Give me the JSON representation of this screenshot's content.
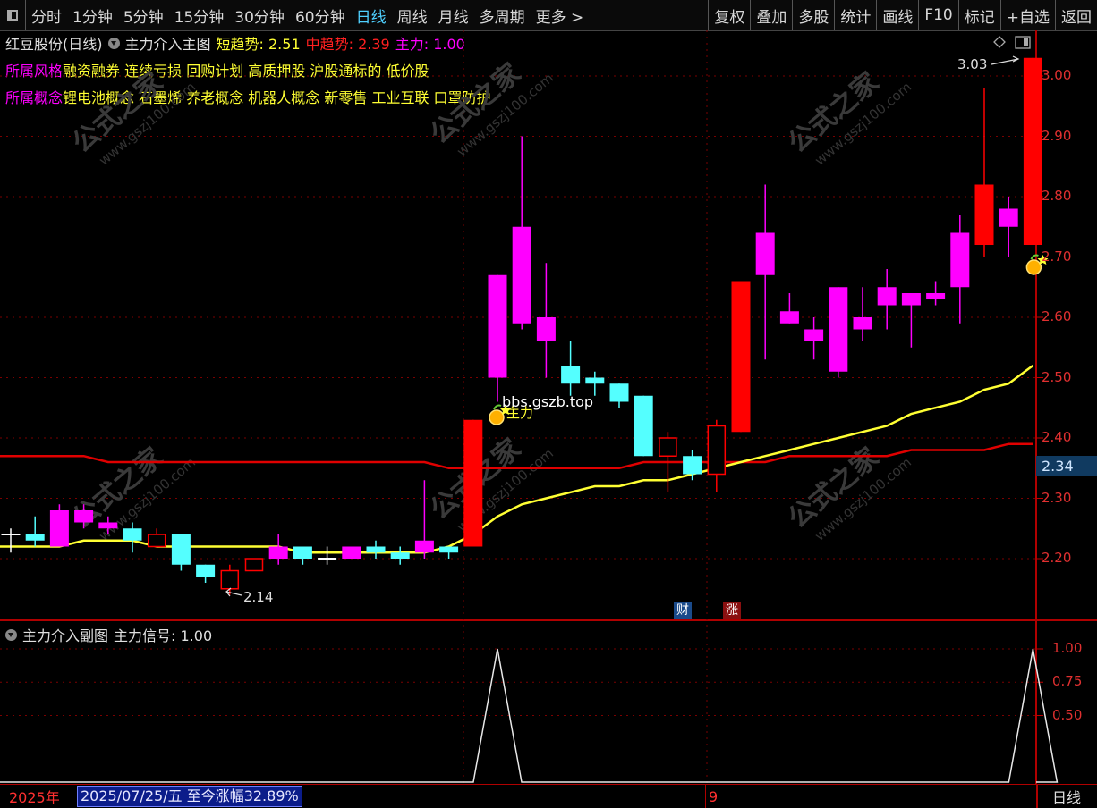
{
  "toolbar": {
    "periods": [
      {
        "label": "分时"
      },
      {
        "label": "1分钟"
      },
      {
        "label": "5分钟"
      },
      {
        "label": "15分钟"
      },
      {
        "label": "30分钟"
      },
      {
        "label": "60分钟"
      },
      {
        "label": "日线",
        "active": true
      },
      {
        "label": "周线"
      },
      {
        "label": "月线"
      },
      {
        "label": "多周期"
      },
      {
        "label": "更多 >"
      }
    ],
    "tools": [
      {
        "label": "复权"
      },
      {
        "label": "叠加"
      },
      {
        "label": "多股"
      },
      {
        "label": "统计"
      },
      {
        "label": "画线"
      },
      {
        "label": "F10"
      },
      {
        "label": "标记"
      },
      {
        "label": "+自选"
      },
      {
        "label": "返回"
      }
    ]
  },
  "main": {
    "stock_title": "红豆股份(日线)",
    "indicator_name": "主力介入主图",
    "short_trend": "短趋势: 2.51",
    "mid_trend": "中趋势: 2.39",
    "main_force": "主力: 1.00",
    "style_label": "所属风格",
    "style_value": "融资融券 连续亏损 回购计划 高质押股 沪股通标的 低价股",
    "concept_label": "所属概念",
    "concept_value": "锂电池概念 石墨烯 养老概念 机器人概念 新零售 工业互联 口罩防护",
    "watermark_text": "公式之家",
    "watermark_url": "www.gszj100.com",
    "overlay_url": "bbs.gszb.top",
    "signal_label": "主力",
    "high_label": "3.03",
    "low_label": "2.14",
    "current_price_label": "2.34",
    "marker_cai": "财",
    "marker_zhang": "涨",
    "price_axis": [
      "3.00",
      "2.90",
      "2.80",
      "2.70",
      "2.60",
      "2.50",
      "2.40",
      "2.30",
      "2.20"
    ]
  },
  "sub": {
    "indicator_name": "主力介入副图",
    "signal": "主力信号: 1.00",
    "axis": [
      "1.00",
      "0.75",
      "0.50"
    ]
  },
  "bottom": {
    "year": "2025年",
    "cursor_info": "2025/07/25/五  至今涨幅32.89%",
    "month_tick": "9",
    "period": "日线"
  },
  "colors": {
    "up": "#ff0000",
    "down": "#54ffff",
    "magenta": "#ff00ff",
    "ma_long": "#e00000",
    "ma_short": "#ffff33",
    "grid": "#7a0000"
  },
  "chart_data": {
    "type": "candlestick",
    "ylim": [
      2.15,
      3.05
    ],
    "candles": [
      {
        "o": 2.23,
        "c": 2.24,
        "h": 2.25,
        "l": 2.21,
        "color": "white"
      },
      {
        "o": 2.23,
        "c": 2.24,
        "h": 2.27,
        "l": 2.22,
        "color": "cyan"
      },
      {
        "o": 2.22,
        "c": 2.28,
        "h": 2.29,
        "l": 2.22,
        "color": "magenta"
      },
      {
        "o": 2.26,
        "c": 2.28,
        "h": 2.29,
        "l": 2.25,
        "color": "magenta"
      },
      {
        "o": 2.25,
        "c": 2.26,
        "h": 2.27,
        "l": 2.24,
        "color": "magenta"
      },
      {
        "o": 2.25,
        "c": 2.23,
        "h": 2.26,
        "l": 2.21,
        "color": "cyan"
      },
      {
        "o": 2.22,
        "c": 2.24,
        "h": 2.25,
        "l": 2.22,
        "color": "red-hollow"
      },
      {
        "o": 2.24,
        "c": 2.19,
        "h": 2.24,
        "l": 2.18,
        "color": "cyan"
      },
      {
        "o": 2.19,
        "c": 2.17,
        "h": 2.19,
        "l": 2.16,
        "color": "cyan"
      },
      {
        "o": 2.15,
        "c": 2.18,
        "h": 2.19,
        "l": 2.14,
        "color": "red-hollow"
      },
      {
        "o": 2.18,
        "c": 2.2,
        "h": 2.2,
        "l": 2.18,
        "color": "red-hollow"
      },
      {
        "o": 2.2,
        "c": 2.22,
        "h": 2.24,
        "l": 2.19,
        "color": "magenta"
      },
      {
        "o": 2.22,
        "c": 2.2,
        "h": 2.22,
        "l": 2.19,
        "color": "cyan"
      },
      {
        "o": 2.2,
        "c": 2.2,
        "h": 2.22,
        "l": 2.19,
        "color": "white"
      },
      {
        "o": 2.2,
        "c": 2.22,
        "h": 2.22,
        "l": 2.2,
        "color": "magenta"
      },
      {
        "o": 2.22,
        "c": 2.21,
        "h": 2.23,
        "l": 2.2,
        "color": "cyan"
      },
      {
        "o": 2.21,
        "c": 2.2,
        "h": 2.22,
        "l": 2.19,
        "color": "cyan"
      },
      {
        "o": 2.21,
        "c": 2.23,
        "h": 2.33,
        "l": 2.2,
        "color": "magenta"
      },
      {
        "o": 2.22,
        "c": 2.21,
        "h": 2.22,
        "l": 2.2,
        "color": "cyan"
      },
      {
        "o": 2.22,
        "c": 2.43,
        "h": 2.43,
        "l": 2.22,
        "color": "red"
      },
      {
        "o": 2.5,
        "c": 2.67,
        "h": 2.67,
        "l": 2.46,
        "color": "magenta"
      },
      {
        "o": 2.59,
        "c": 2.75,
        "h": 2.9,
        "l": 2.58,
        "color": "magenta"
      },
      {
        "o": 2.6,
        "c": 2.56,
        "h": 2.69,
        "l": 2.5,
        "color": "magenta"
      },
      {
        "o": 2.52,
        "c": 2.49,
        "h": 2.56,
        "l": 2.47,
        "color": "cyan"
      },
      {
        "o": 2.5,
        "c": 2.49,
        "h": 2.51,
        "l": 2.47,
        "color": "cyan"
      },
      {
        "o": 2.49,
        "c": 2.46,
        "h": 2.49,
        "l": 2.45,
        "color": "cyan"
      },
      {
        "o": 2.47,
        "c": 2.37,
        "h": 2.47,
        "l": 2.37,
        "color": "cyan"
      },
      {
        "o": 2.37,
        "c": 2.4,
        "h": 2.41,
        "l": 2.31,
        "color": "red-hollow"
      },
      {
        "o": 2.37,
        "c": 2.34,
        "h": 2.38,
        "l": 2.33,
        "color": "cyan"
      },
      {
        "o": 2.34,
        "c": 2.42,
        "h": 2.43,
        "l": 2.31,
        "color": "red-hollow"
      },
      {
        "o": 2.41,
        "c": 2.66,
        "h": 2.66,
        "l": 2.41,
        "color": "red"
      },
      {
        "o": 2.67,
        "c": 2.74,
        "h": 2.82,
        "l": 2.53,
        "color": "magenta"
      },
      {
        "o": 2.61,
        "c": 2.59,
        "h": 2.64,
        "l": 2.59,
        "color": "magenta"
      },
      {
        "o": 2.58,
        "c": 2.56,
        "h": 2.6,
        "l": 2.53,
        "color": "magenta"
      },
      {
        "o": 2.51,
        "c": 2.65,
        "h": 2.65,
        "l": 2.5,
        "color": "magenta"
      },
      {
        "o": 2.6,
        "c": 2.58,
        "h": 2.65,
        "l": 2.56,
        "color": "magenta"
      },
      {
        "o": 2.62,
        "c": 2.65,
        "h": 2.68,
        "l": 2.58,
        "color": "magenta"
      },
      {
        "o": 2.64,
        "c": 2.62,
        "h": 2.64,
        "l": 2.55,
        "color": "magenta"
      },
      {
        "o": 2.63,
        "c": 2.64,
        "h": 2.66,
        "l": 2.62,
        "color": "magenta"
      },
      {
        "o": 2.65,
        "c": 2.74,
        "h": 2.77,
        "l": 2.59,
        "color": "magenta"
      },
      {
        "o": 2.72,
        "c": 2.82,
        "h": 2.98,
        "l": 2.7,
        "color": "red"
      },
      {
        "o": 2.75,
        "c": 2.78,
        "h": 2.8,
        "l": 2.7,
        "color": "magenta"
      },
      {
        "o": 2.72,
        "c": 3.03,
        "h": 3.03,
        "l": 2.72,
        "color": "red"
      }
    ],
    "ma_short": [
      2.22,
      2.22,
      2.22,
      2.23,
      2.23,
      2.23,
      2.22,
      2.22,
      2.22,
      2.22,
      2.22,
      2.22,
      2.21,
      2.21,
      2.21,
      2.21,
      2.21,
      2.21,
      2.22,
      2.24,
      2.27,
      2.29,
      2.3,
      2.31,
      2.32,
      2.32,
      2.33,
      2.33,
      2.34,
      2.35,
      2.36,
      2.37,
      2.38,
      2.39,
      2.4,
      2.41,
      2.42,
      2.44,
      2.45,
      2.46,
      2.48,
      2.49,
      2.52
    ],
    "ma_long": [
      2.37,
      2.37,
      2.37,
      2.37,
      2.36,
      2.36,
      2.36,
      2.36,
      2.36,
      2.36,
      2.36,
      2.36,
      2.36,
      2.36,
      2.36,
      2.36,
      2.36,
      2.36,
      2.35,
      2.35,
      2.35,
      2.35,
      2.35,
      2.35,
      2.35,
      2.35,
      2.36,
      2.36,
      2.36,
      2.36,
      2.36,
      2.36,
      2.37,
      2.37,
      2.37,
      2.37,
      2.37,
      2.38,
      2.38,
      2.38,
      2.38,
      2.39,
      2.39
    ],
    "signal": [
      0,
      0,
      0,
      0,
      0,
      0,
      0,
      0,
      0,
      0,
      0,
      0,
      0,
      0,
      0,
      0,
      0,
      0,
      0,
      0,
      1,
      0,
      0,
      0,
      0,
      0,
      0,
      0,
      0,
      0,
      0,
      0,
      0,
      0,
      0,
      0,
      0,
      0,
      0,
      0,
      0,
      0,
      1
    ],
    "signal_ylim": [
      0,
      1
    ]
  }
}
